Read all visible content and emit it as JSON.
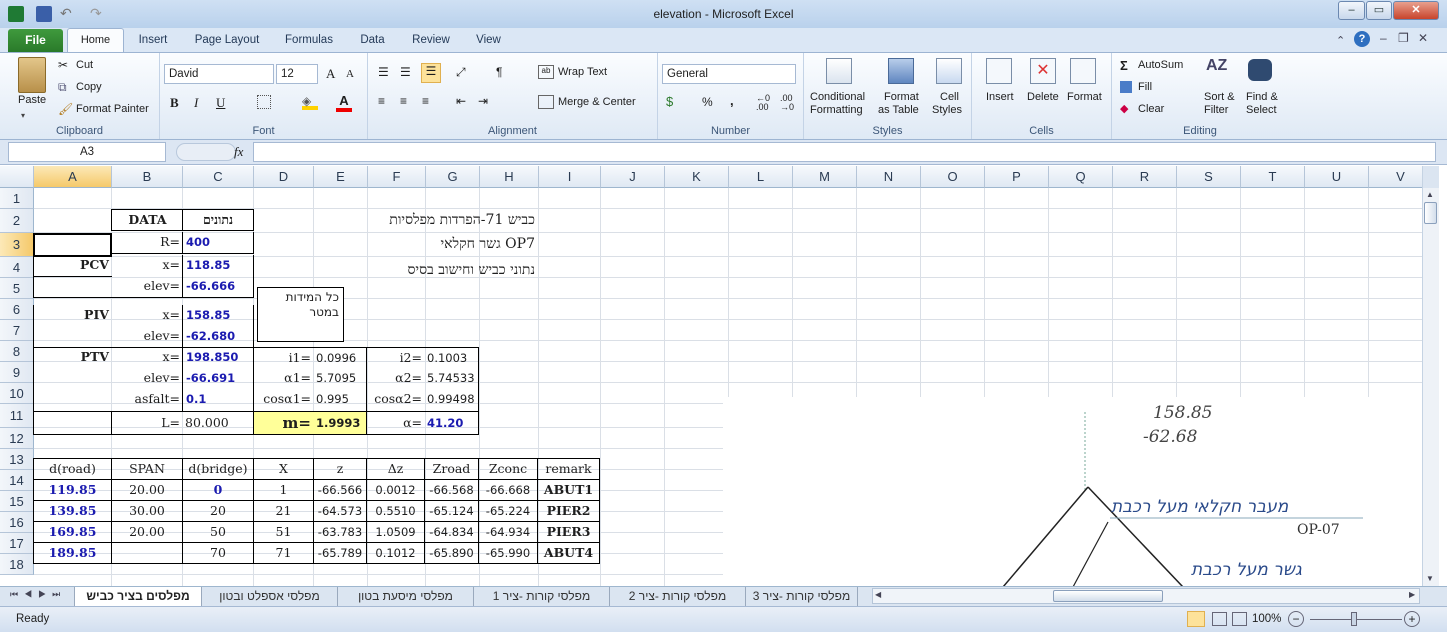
{
  "window": {
    "title": "elevation  -  Microsoft Excel",
    "min": "–",
    "max": "▭",
    "close": "✕"
  },
  "ribbon_tabs": [
    "File",
    "Home",
    "Insert",
    "Page Layout",
    "Formulas",
    "Data",
    "Review",
    "View"
  ],
  "clipboard": {
    "paste": "Paste",
    "cut": "Cut",
    "copy": "Copy",
    "format_painter": "Format Painter",
    "label": "Clipboard"
  },
  "font": {
    "name": "David",
    "size": "12",
    "bold": "B",
    "italic": "I",
    "underline": "U",
    "grow": "A",
    "shrink": "A",
    "label": "Font"
  },
  "alignment": {
    "wrap": "Wrap Text",
    "merge": "Merge & Center",
    "label": "Alignment"
  },
  "number": {
    "format": "General",
    "percent": "%",
    "comma": ",",
    "label": "Number"
  },
  "styles": {
    "conditional": "Conditional",
    "conditional2": "Formatting",
    "table": "Format",
    "table2": "as Table",
    "cell": "Cell",
    "cell2": "Styles",
    "label": "Styles"
  },
  "cells": {
    "insert": "Insert",
    "delete": "Delete",
    "format": "Format",
    "label": "Cells"
  },
  "editing": {
    "autosum": "AutoSum",
    "fill": "Fill",
    "clear": "Clear",
    "sort": "Sort &",
    "sort2": "Filter",
    "find": "Find &",
    "find2": "Select",
    "label": "Editing"
  },
  "formula_bar": {
    "name_box": "A3",
    "fx": "fx",
    "content": ""
  },
  "columns": [
    "A",
    "B",
    "C",
    "D",
    "E",
    "F",
    "G",
    "H",
    "I",
    "J",
    "K",
    "L",
    "M",
    "N",
    "O",
    "P",
    "Q",
    "R",
    "S",
    "T",
    "U",
    "V"
  ],
  "rows": [
    "1",
    "2",
    "3",
    "4",
    "5",
    "6",
    "7",
    "8",
    "9",
    "10",
    "11",
    "12",
    "13",
    "14",
    "15",
    "16",
    "17",
    "18"
  ],
  "cells_data": {
    "b2": "DATA",
    "c2": "נתונים",
    "title1": "כביש 71-הפרדות מפלסיות",
    "b3": "R=",
    "c3": "400",
    "title2": "גשר חקלאי OP7",
    "a4": "PCV",
    "b4": "x=",
    "c4": "118.85",
    "title3": "נתוני כביש וחישוב בסיס",
    "b5": "elev=",
    "c5": "-66.666",
    "note": "כל המידות במטר",
    "a6": "PIV",
    "b6": "x=",
    "c6": "158.85",
    "b7": "elev=",
    "c7": "-62.680",
    "a8": "PTV",
    "b8": "x=",
    "c8": "198.850",
    "d8": "i1=",
    "e8": "0.0996",
    "f8": "i2=",
    "g8": "0.1003",
    "b9": "elev=",
    "c9": "-66.691",
    "d9": "α1=",
    "e9": "5.7095",
    "f9": "α2=",
    "g9": "5.74533",
    "b10": "asfalt=",
    "c10": "0.1",
    "d10": "cosα1=",
    "e10": "0.995",
    "f10": "cosα2=",
    "g10": "0.99498",
    "b11": "L=",
    "c11": "80.000",
    "d11": "m=",
    "e11": "1.9993",
    "f11": "α=",
    "g11": "41.20"
  },
  "table": {
    "headers": [
      "d(road)",
      "SPAN",
      "d(bridge)",
      "X",
      "z",
      "Δz",
      "Zroad",
      "Zconc",
      "remark"
    ],
    "rows": [
      [
        "119.85",
        "20.00",
        "0",
        "1",
        "-66.566",
        "0.0012",
        "-66.568",
        "-66.668",
        "ABUT1"
      ],
      [
        "139.85",
        "30.00",
        "20",
        "21",
        "-64.573",
        "0.5510",
        "-65.124",
        "-65.224",
        "PIER2"
      ],
      [
        "169.85",
        "20.00",
        "50",
        "51",
        "-63.783",
        "1.0509",
        "-64.834",
        "-64.934",
        "PIER3"
      ],
      [
        "189.85",
        "",
        "70",
        "71",
        "-65.789",
        "0.1012",
        "-65.890",
        "-65.990",
        "ABUT4"
      ]
    ]
  },
  "drawing": {
    "t1": "158.85",
    "t2": "-62.68",
    "t3": "מעבר חקלאי מעל רכבת",
    "t4": "OP-07",
    "t5": "גשר מעל רכבת"
  },
  "sheet_tabs": [
    "מפלסים בציר כביש",
    "מפלסי אספלט ובטון",
    "מפלסי מיסעת בטון",
    "מפלסי קורות -ציר 1",
    "מפלסי קורות -ציר 2",
    "מפלסי קורות -ציר 3"
  ],
  "status": {
    "ready": "Ready",
    "zoom": "100%"
  }
}
